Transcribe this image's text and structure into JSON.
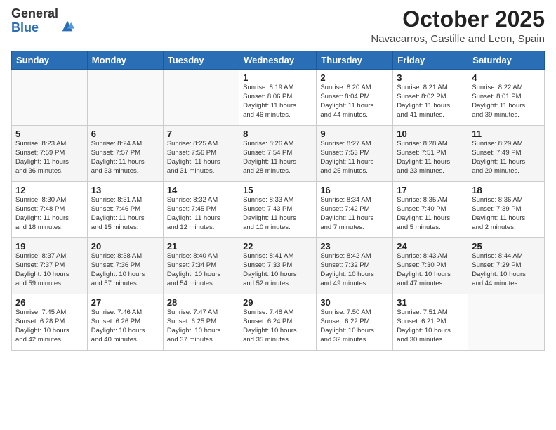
{
  "logo": {
    "general": "General",
    "blue": "Blue"
  },
  "title": "October 2025",
  "location": "Navacarros, Castille and Leon, Spain",
  "days_header": [
    "Sunday",
    "Monday",
    "Tuesday",
    "Wednesday",
    "Thursday",
    "Friday",
    "Saturday"
  ],
  "weeks": [
    [
      {
        "day": "",
        "info": ""
      },
      {
        "day": "",
        "info": ""
      },
      {
        "day": "",
        "info": ""
      },
      {
        "day": "1",
        "info": "Sunrise: 8:19 AM\nSunset: 8:06 PM\nDaylight: 11 hours\nand 46 minutes."
      },
      {
        "day": "2",
        "info": "Sunrise: 8:20 AM\nSunset: 8:04 PM\nDaylight: 11 hours\nand 44 minutes."
      },
      {
        "day": "3",
        "info": "Sunrise: 8:21 AM\nSunset: 8:02 PM\nDaylight: 11 hours\nand 41 minutes."
      },
      {
        "day": "4",
        "info": "Sunrise: 8:22 AM\nSunset: 8:01 PM\nDaylight: 11 hours\nand 39 minutes."
      }
    ],
    [
      {
        "day": "5",
        "info": "Sunrise: 8:23 AM\nSunset: 7:59 PM\nDaylight: 11 hours\nand 36 minutes."
      },
      {
        "day": "6",
        "info": "Sunrise: 8:24 AM\nSunset: 7:57 PM\nDaylight: 11 hours\nand 33 minutes."
      },
      {
        "day": "7",
        "info": "Sunrise: 8:25 AM\nSunset: 7:56 PM\nDaylight: 11 hours\nand 31 minutes."
      },
      {
        "day": "8",
        "info": "Sunrise: 8:26 AM\nSunset: 7:54 PM\nDaylight: 11 hours\nand 28 minutes."
      },
      {
        "day": "9",
        "info": "Sunrise: 8:27 AM\nSunset: 7:53 PM\nDaylight: 11 hours\nand 25 minutes."
      },
      {
        "day": "10",
        "info": "Sunrise: 8:28 AM\nSunset: 7:51 PM\nDaylight: 11 hours\nand 23 minutes."
      },
      {
        "day": "11",
        "info": "Sunrise: 8:29 AM\nSunset: 7:49 PM\nDaylight: 11 hours\nand 20 minutes."
      }
    ],
    [
      {
        "day": "12",
        "info": "Sunrise: 8:30 AM\nSunset: 7:48 PM\nDaylight: 11 hours\nand 18 minutes."
      },
      {
        "day": "13",
        "info": "Sunrise: 8:31 AM\nSunset: 7:46 PM\nDaylight: 11 hours\nand 15 minutes."
      },
      {
        "day": "14",
        "info": "Sunrise: 8:32 AM\nSunset: 7:45 PM\nDaylight: 11 hours\nand 12 minutes."
      },
      {
        "day": "15",
        "info": "Sunrise: 8:33 AM\nSunset: 7:43 PM\nDaylight: 11 hours\nand 10 minutes."
      },
      {
        "day": "16",
        "info": "Sunrise: 8:34 AM\nSunset: 7:42 PM\nDaylight: 11 hours\nand 7 minutes."
      },
      {
        "day": "17",
        "info": "Sunrise: 8:35 AM\nSunset: 7:40 PM\nDaylight: 11 hours\nand 5 minutes."
      },
      {
        "day": "18",
        "info": "Sunrise: 8:36 AM\nSunset: 7:39 PM\nDaylight: 11 hours\nand 2 minutes."
      }
    ],
    [
      {
        "day": "19",
        "info": "Sunrise: 8:37 AM\nSunset: 7:37 PM\nDaylight: 10 hours\nand 59 minutes."
      },
      {
        "day": "20",
        "info": "Sunrise: 8:38 AM\nSunset: 7:36 PM\nDaylight: 10 hours\nand 57 minutes."
      },
      {
        "day": "21",
        "info": "Sunrise: 8:40 AM\nSunset: 7:34 PM\nDaylight: 10 hours\nand 54 minutes."
      },
      {
        "day": "22",
        "info": "Sunrise: 8:41 AM\nSunset: 7:33 PM\nDaylight: 10 hours\nand 52 minutes."
      },
      {
        "day": "23",
        "info": "Sunrise: 8:42 AM\nSunset: 7:32 PM\nDaylight: 10 hours\nand 49 minutes."
      },
      {
        "day": "24",
        "info": "Sunrise: 8:43 AM\nSunset: 7:30 PM\nDaylight: 10 hours\nand 47 minutes."
      },
      {
        "day": "25",
        "info": "Sunrise: 8:44 AM\nSunset: 7:29 PM\nDaylight: 10 hours\nand 44 minutes."
      }
    ],
    [
      {
        "day": "26",
        "info": "Sunrise: 7:45 AM\nSunset: 6:28 PM\nDaylight: 10 hours\nand 42 minutes."
      },
      {
        "day": "27",
        "info": "Sunrise: 7:46 AM\nSunset: 6:26 PM\nDaylight: 10 hours\nand 40 minutes."
      },
      {
        "day": "28",
        "info": "Sunrise: 7:47 AM\nSunset: 6:25 PM\nDaylight: 10 hours\nand 37 minutes."
      },
      {
        "day": "29",
        "info": "Sunrise: 7:48 AM\nSunset: 6:24 PM\nDaylight: 10 hours\nand 35 minutes."
      },
      {
        "day": "30",
        "info": "Sunrise: 7:50 AM\nSunset: 6:22 PM\nDaylight: 10 hours\nand 32 minutes."
      },
      {
        "day": "31",
        "info": "Sunrise: 7:51 AM\nSunset: 6:21 PM\nDaylight: 10 hours\nand 30 minutes."
      },
      {
        "day": "",
        "info": ""
      }
    ]
  ]
}
